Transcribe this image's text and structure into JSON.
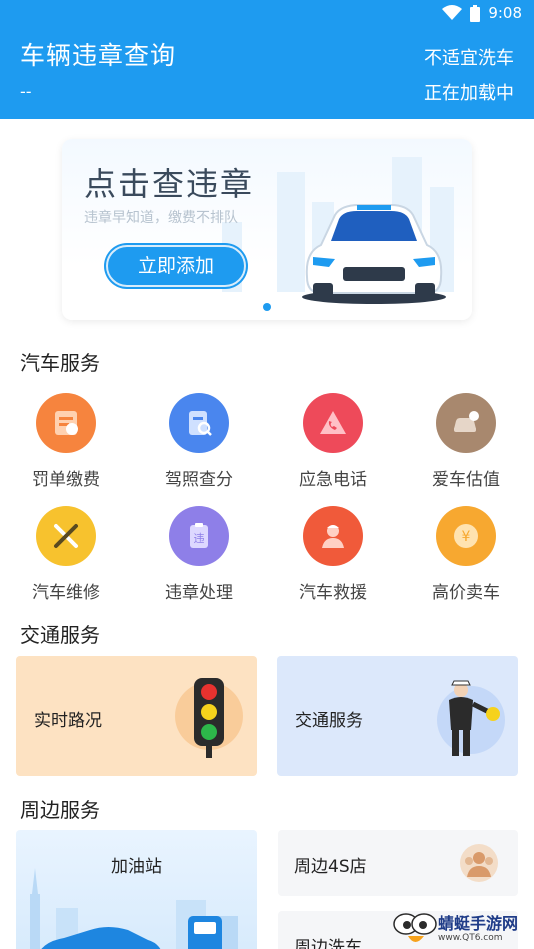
{
  "status_bar": {
    "time": "9:08"
  },
  "header": {
    "title": "车辆违章查询",
    "car_wash": "不适宜洗车",
    "city": "--",
    "loading": "正在加载中"
  },
  "banner": {
    "title": "点击查违章",
    "subtitle": "违章早知道，缴费不排队",
    "button": "立即添加"
  },
  "car_services": {
    "title": "汽车服务",
    "items": [
      {
        "label": "罚单缴费",
        "icon": "ticket-payment-icon",
        "color": "#f6843e"
      },
      {
        "label": "驾照查分",
        "icon": "license-query-icon",
        "color": "#4a86ee"
      },
      {
        "label": "应急电话",
        "icon": "emergency-phone-icon",
        "color": "#ee4a5a"
      },
      {
        "label": "爱车估值",
        "icon": "car-valuation-icon",
        "color": "#a8886e"
      },
      {
        "label": "汽车维修",
        "icon": "car-repair-icon",
        "color": "#f7c22e"
      },
      {
        "label": "违章处理",
        "icon": "violation-handling-icon",
        "color": "#8e7fe8"
      },
      {
        "label": "汽车救援",
        "icon": "car-rescue-icon",
        "color": "#f05a3a"
      },
      {
        "label": "高价卖车",
        "icon": "sell-car-icon",
        "color": "#f7a830"
      }
    ]
  },
  "traffic_services": {
    "title": "交通服务",
    "cards": [
      {
        "label": "实时路况",
        "icon": "traffic-light-icon",
        "bg": "#fde2c2"
      },
      {
        "label": "交通服务",
        "icon": "traffic-police-icon",
        "bg": "#dce8fb"
      }
    ]
  },
  "nearby_services": {
    "title": "周边服务",
    "gas_station": "加油站",
    "shop_4s": "周边4S店",
    "car_wash": "周边洗车"
  },
  "watermark": {
    "name": "蜻蜓手游网",
    "url": "www.QT6.com"
  }
}
